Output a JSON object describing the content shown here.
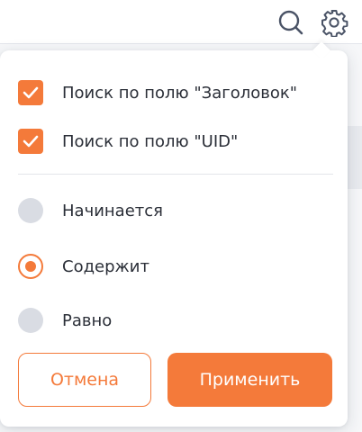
{
  "header": {
    "search_icon": "search-icon",
    "settings_icon": "gear-icon"
  },
  "popover": {
    "checkboxes": [
      {
        "label": "Поиск по полю \"Заголовок\"",
        "checked": true
      },
      {
        "label": "Поиск по полю \"UID\"",
        "checked": true
      }
    ],
    "radios": [
      {
        "label": "Начинается",
        "selected": false
      },
      {
        "label": "Содержит",
        "selected": true
      },
      {
        "label": "Равно",
        "selected": false
      }
    ],
    "cancel_label": "Отмена",
    "apply_label": "Применить"
  },
  "colors": {
    "accent": "#f47a3a",
    "radio_inactive": "#d9dce3",
    "text": "#2b2f38"
  }
}
